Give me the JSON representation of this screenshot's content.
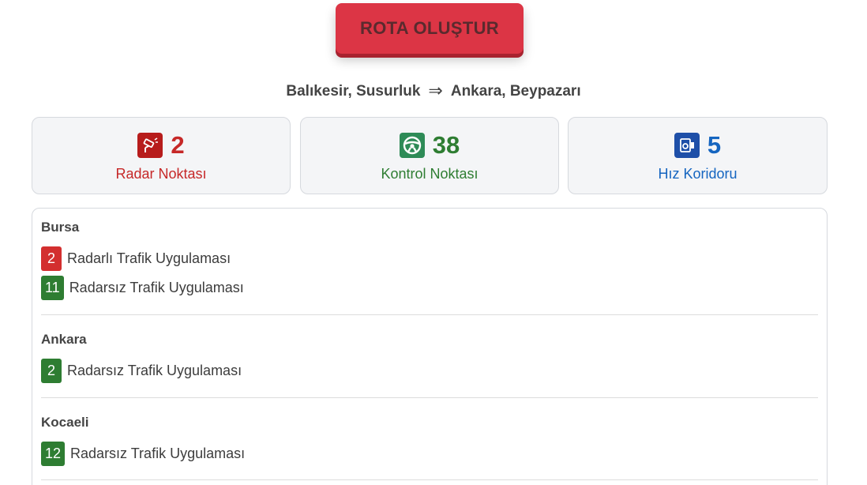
{
  "route_button": {
    "label": "ROTA OLUŞTUR"
  },
  "route": {
    "from": "Balıkesir, Susurluk",
    "arrow": "⇒",
    "to": "Ankara, Beypazarı"
  },
  "stats": [
    {
      "icon": "speed-camera-icon",
      "value": "2",
      "label": "Radar Noktası",
      "color": "#c62828"
    },
    {
      "icon": "steering-wheel-icon",
      "value": "38",
      "label": "Kontrol Noktası",
      "color": "#2e7d32"
    },
    {
      "icon": "speed-corridor-icon",
      "value": "5",
      "label": "Hız Koridoru",
      "color": "#1565c0"
    }
  ],
  "cities": [
    {
      "name": "Bursa",
      "entries": [
        {
          "count": "2",
          "type": "radar",
          "label": "Radarlı Trafik Uygulaması"
        },
        {
          "count": "11",
          "type": "control",
          "label": "Radarsız Trafik Uygulaması"
        }
      ]
    },
    {
      "name": "Ankara",
      "entries": [
        {
          "count": "2",
          "type": "control",
          "label": "Radarsız Trafik Uygulaması"
        }
      ]
    },
    {
      "name": "Kocaeli",
      "entries": [
        {
          "count": "12",
          "type": "control",
          "label": "Radarsız Trafik Uygulaması"
        }
      ]
    }
  ]
}
